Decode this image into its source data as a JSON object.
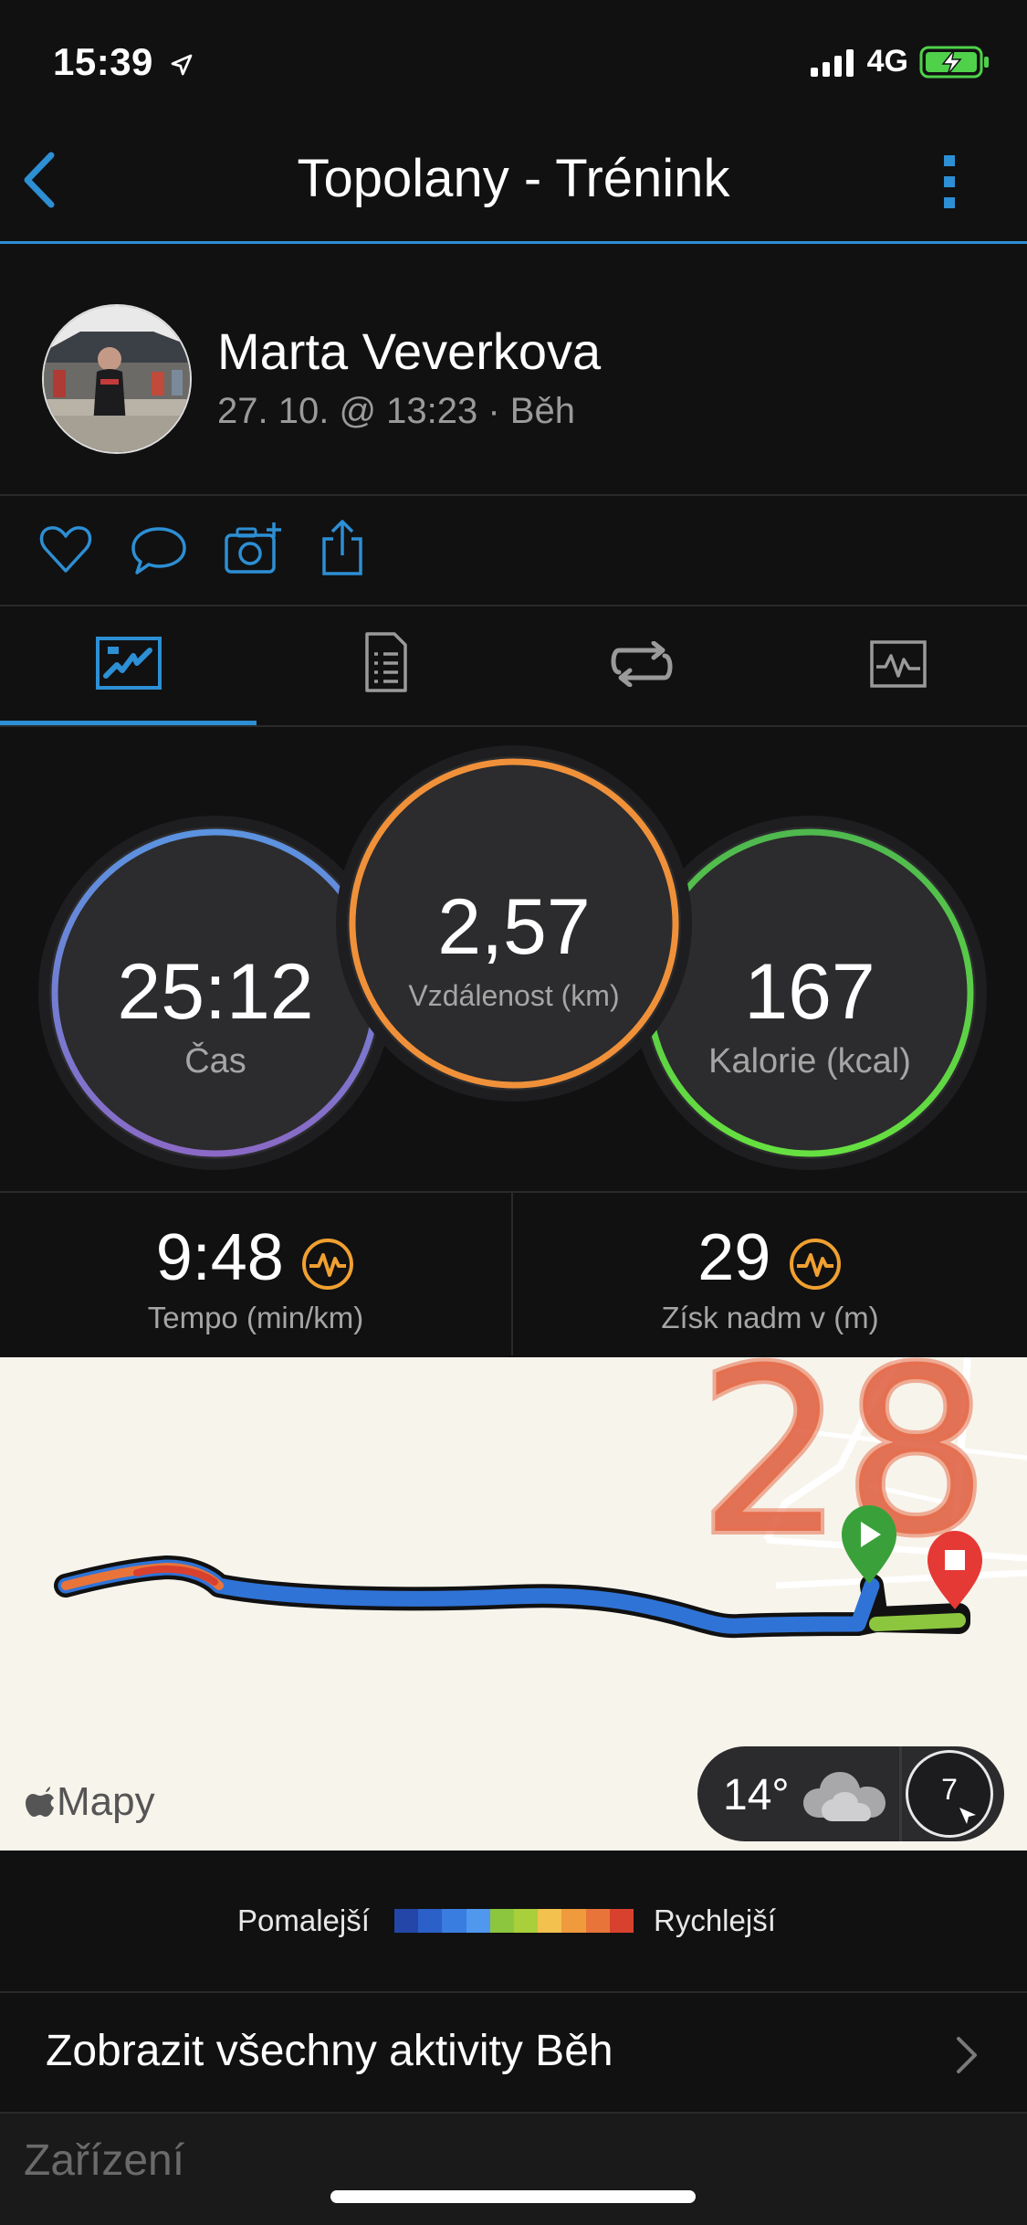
{
  "status_bar": {
    "time": "15:39",
    "network": "4G"
  },
  "nav": {
    "title": "Topolany - Trénink"
  },
  "profile": {
    "name": "Marta Veverkova",
    "meta": "27. 10. @ 13:23 · Běh"
  },
  "stats": {
    "time": {
      "value": "25:12",
      "label": "Čas"
    },
    "distance": {
      "value": "2,57",
      "label": "Vzdálenost (km)"
    },
    "calories": {
      "value": "167",
      "label": "Kalorie (kcal)"
    }
  },
  "metrics": {
    "pace": {
      "value": "9:48",
      "label": "Tempo (min/km)"
    },
    "elevation": {
      "value": "29",
      "label": "Získ nadm v (m)"
    }
  },
  "map": {
    "attribution": "Mapy",
    "annotation": "28",
    "weather_temp": "14°",
    "compass_value": "7"
  },
  "legend": {
    "slower_label": "Pomalejší",
    "faster_label": "Rychlejší",
    "colors": [
      "#2346a8",
      "#2b60c8",
      "#3a7de0",
      "#4f98ee",
      "#8cc63f",
      "#a9cf3a",
      "#f2c14e",
      "#f09a3e",
      "#e8743a",
      "#d9412f"
    ]
  },
  "list": {
    "all_activities": "Zobrazit všechny aktivity Běh",
    "section_devices": "Zařízení"
  },
  "colors": {
    "accent": "#2d8fd4",
    "ring_time": "#5b8fe0",
    "ring_distance": "#f0913a",
    "ring_calories": "#4fd14a"
  }
}
